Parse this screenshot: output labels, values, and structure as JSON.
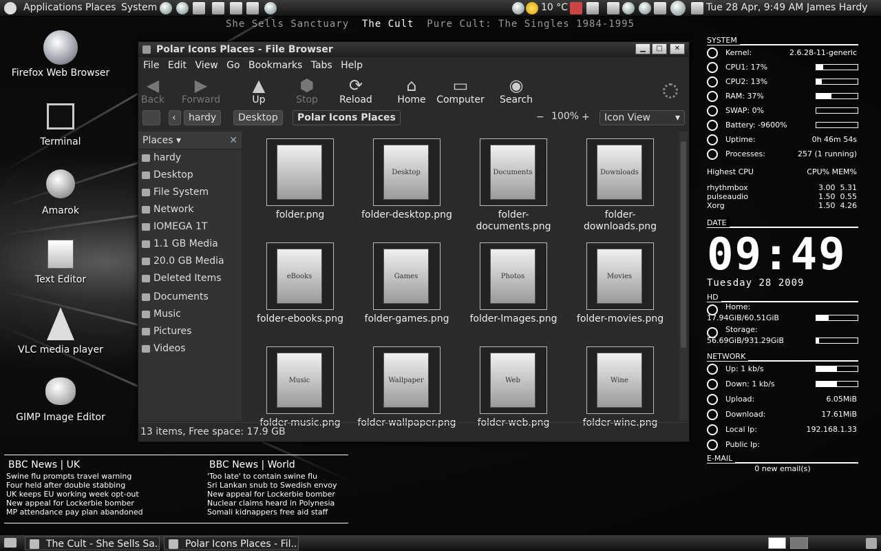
{
  "top_panel": {
    "menus": [
      "Applications",
      "Places",
      "System"
    ],
    "weather": "10 °C",
    "clock": "Tue 28 Apr,  9:49 AM",
    "user": "James Hardy"
  },
  "now_playing": {
    "title": "She Sells Sanctuary",
    "artist": "The Cult",
    "album": "Pure Cult: The Singles 1984-1995"
  },
  "desktop_icons": [
    {
      "label": "Firefox Web Browser"
    },
    {
      "label": "Terminal"
    },
    {
      "label": "Amarok"
    },
    {
      "label": "Text Editor"
    },
    {
      "label": "VLC media player"
    },
    {
      "label": "GIMP Image Editor"
    }
  ],
  "window": {
    "title": "Polar Icons Places - File Browser",
    "menu": [
      "File",
      "Edit",
      "View",
      "Go",
      "Bookmarks",
      "Tabs",
      "Help"
    ],
    "toolbar": {
      "back": "Back",
      "forward": "Forward",
      "up": "Up",
      "stop": "Stop",
      "reload": "Reload",
      "home": "Home",
      "computer": "Computer",
      "search": "Search"
    },
    "location": {
      "crumbs": [
        "hardy",
        "Desktop"
      ],
      "current": "Polar Icons Places",
      "zoom": "100%",
      "view": "Icon View"
    },
    "sidebar": {
      "header": "Places",
      "items": [
        "hardy",
        "Desktop",
        "File System",
        "Network",
        "IOMEGA 1T",
        "1.1 GB Media",
        "20.0 GB Media",
        "Deleted Items",
        "Documents",
        "Music",
        "Pictures",
        "Videos"
      ]
    },
    "files": [
      {
        "name": "folder.png",
        "art": ""
      },
      {
        "name": "folder-desktop.png",
        "art": "Desktop"
      },
      {
        "name": "folder-documents.png",
        "art": "Documents"
      },
      {
        "name": "folder-downloads.png",
        "art": "Downloads"
      },
      {
        "name": "folder-ebooks.png",
        "art": "eBooks"
      },
      {
        "name": "folder-games.png",
        "art": "Games"
      },
      {
        "name": "folder-Images.png",
        "art": "Photos"
      },
      {
        "name": "folder-movies.png",
        "art": "Movies"
      },
      {
        "name": "folder-music.png",
        "art": "Music"
      },
      {
        "name": "folder-wallpaper.png",
        "art": "Wallpaper"
      },
      {
        "name": "folder-web.png",
        "art": "Web"
      },
      {
        "name": "folder-wine.png",
        "art": "Wine"
      }
    ],
    "status": "13 items, Free space: 17.9 GB"
  },
  "conky": {
    "system_label": "SYSTEM",
    "system": [
      {
        "label": "Kernel:",
        "value": "2.6.28-11-generic"
      },
      {
        "label": "CPU1: 17%",
        "level": 0.17
      },
      {
        "label": "CPU2: 13%",
        "level": 0.13
      },
      {
        "label": "RAM: 37%",
        "level": 0.37
      },
      {
        "label": "SWAP: 0%",
        "level": 0.0
      },
      {
        "label": "Battery: -9600%",
        "level": 0.0
      },
      {
        "label": "Uptime:",
        "value": "0h 46m 54s"
      },
      {
        "label": "Processes:",
        "value": "257 (1 running)"
      }
    ],
    "top_header": "Highest CPU",
    "top_cols": "CPU% MEM%",
    "top": [
      {
        "name": "rhythmbox",
        "vals": "3.00  5.31"
      },
      {
        "name": "pulseaudio",
        "vals": "1.50  0.55"
      },
      {
        "name": "Xorg",
        "vals": "1.50  4.26"
      }
    ],
    "date_label": "DATE",
    "time": "09:49",
    "date": "Tuesday 28 2009",
    "hd_label": "HD",
    "hd": [
      {
        "label": "Home:",
        "value": "17.94GiB/60.51GiB",
        "level": 0.3
      },
      {
        "label": "Storage:",
        "value": "56.69GiB/931.29GiB",
        "level": 0.06
      }
    ],
    "network_label": "NETWORK",
    "network": [
      {
        "label": "Up: 1 kb/s",
        "level": 0.5
      },
      {
        "label": "Down: 1 kb/s",
        "level": 0.5
      },
      {
        "label": "Upload:",
        "value": "6.05MiB"
      },
      {
        "label": "Download:",
        "value": "17.61MiB"
      },
      {
        "label": "Local Ip:",
        "value": "192.168.1.33"
      },
      {
        "label": "Public Ip:",
        "value": ""
      }
    ],
    "email_label": "E-MAIL",
    "email": "0 new email(s)"
  },
  "news": {
    "uk": {
      "header": "BBC News | UK",
      "items": [
        "Swine flu prompts travel warning",
        "Four held after double stabbing",
        "UK keeps EU working week opt-out",
        "New appeal for Lockerbie bomber",
        "MP attendance pay plan abandoned"
      ]
    },
    "world": {
      "header": "BBC News | World",
      "items": [
        "'Too late' to contain swine flu",
        "Sri Lankan snub to Swedish envoy",
        "New appeal for Lockerbie bomber",
        "Nuclear claims heard in Polynesia",
        "Somali kidnappers free aid staff"
      ]
    }
  },
  "taskbar": [
    "The Cult - She Sells Sa...",
    "Polar Icons Places - Fil..."
  ]
}
